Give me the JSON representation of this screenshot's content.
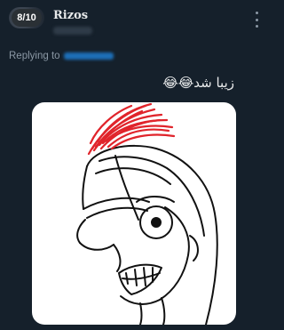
{
  "tweet": {
    "counter": "8/10",
    "author_name": "Rizos",
    "replying_label": "Replying to",
    "text": "زیبا شد😂😂",
    "media_alt": "Doodle of a cartoon face wearing a helmet with a red plume"
  },
  "colors": {
    "background": "#15202b",
    "text": "#e7e9ea",
    "muted": "#8b98a5",
    "link": "#1d9bf0",
    "plume": "#e0242b"
  },
  "icons": {
    "more": "more-vertical-icon"
  }
}
